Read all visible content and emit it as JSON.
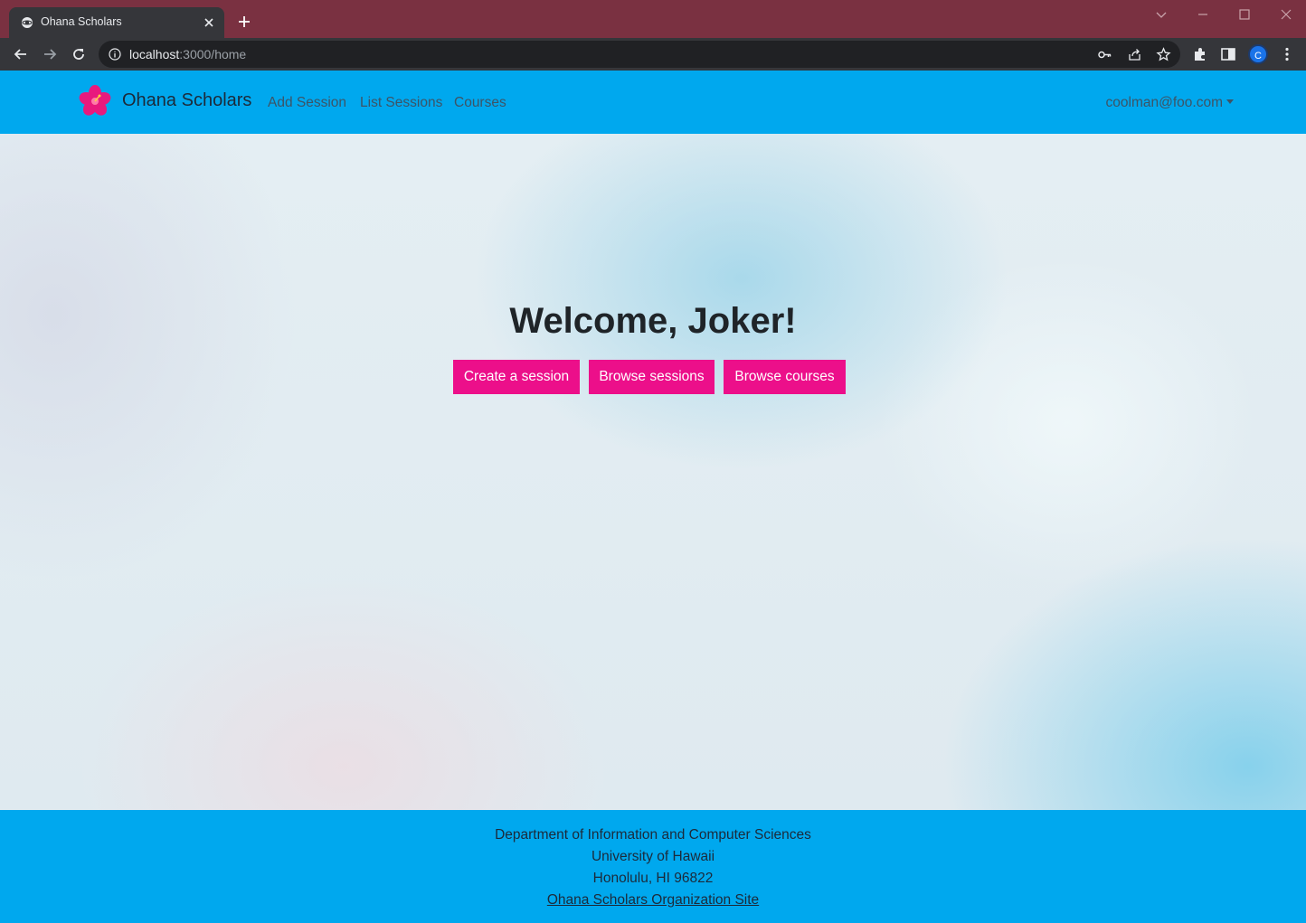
{
  "browser": {
    "tab_title": "Ohana Scholars",
    "url_host": "localhost",
    "url_rest": ":3000/home",
    "profile_initial": "C",
    "accent": "#7a3141"
  },
  "navbar": {
    "brand": "Ohana Scholars",
    "links": [
      "Add Session",
      "List Sessions",
      "Courses"
    ],
    "user": "coolman@foo.com",
    "bg_color": "#00a8ee"
  },
  "hero": {
    "welcome": "Welcome, Joker!",
    "buttons": [
      "Create a session",
      "Browse sessions",
      "Browse courses"
    ],
    "button_color": "#ec0f8a"
  },
  "footer": {
    "lines": [
      "Department of Information and Computer Sciences",
      "University of Hawaii",
      "Honolulu, HI 96822"
    ],
    "link": "Ohana Scholars Organization Site"
  },
  "icons": {
    "favicon": "react-favicon-icon",
    "logo": "hibiscus-flower-icon"
  }
}
